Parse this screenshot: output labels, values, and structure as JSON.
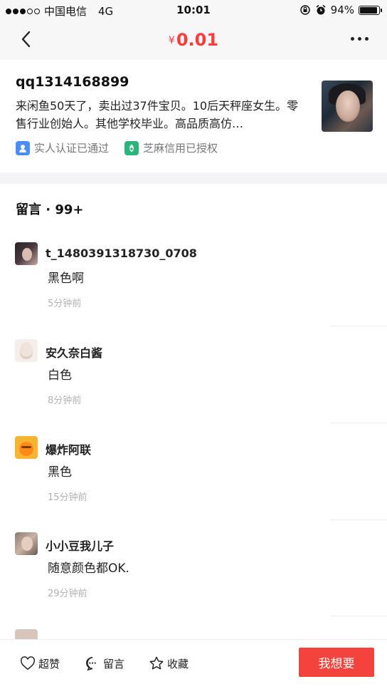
{
  "status_bar": {
    "carrier": "中国电信",
    "network": "4G",
    "time": "10:01",
    "battery": "94%",
    "battery_level": 0.94
  },
  "nav": {
    "currency": "¥",
    "price": "0.01"
  },
  "seller": {
    "name": "qq1314168899",
    "bio": "来闲鱼50天了，卖出过37件宝贝。10后天秤座女生。零售行业创始人。其他学校毕业。高品质高仿…",
    "badges": [
      {
        "label": "实人认证已通过",
        "icon": "person-verified-icon",
        "color": "#4a8ef5"
      },
      {
        "label": "芝麻信用已授权",
        "icon": "sesame-credit-icon",
        "color": "#2bb57a"
      }
    ]
  },
  "comments": {
    "header": "留言 · 99+",
    "items": [
      {
        "user": "t_1480391318730_0708",
        "text": "黑色啊",
        "time": "5分钟前"
      },
      {
        "user": "安久奈白酱",
        "text": "白色",
        "time": "8分钟前"
      },
      {
        "user": "爆炸阿联",
        "text": "黑色",
        "time": "15分钟前"
      },
      {
        "user": "小小豆我儿子",
        "text": "随意颜色都OK.",
        "time": "29分钟前"
      }
    ]
  },
  "bottom_bar": {
    "like_label": "超赞",
    "comment_label": "留言",
    "favorite_label": "收藏",
    "want_label": "我想要"
  },
  "colors": {
    "price_red": "#ff3b3b",
    "want_button": "#f4433c"
  }
}
